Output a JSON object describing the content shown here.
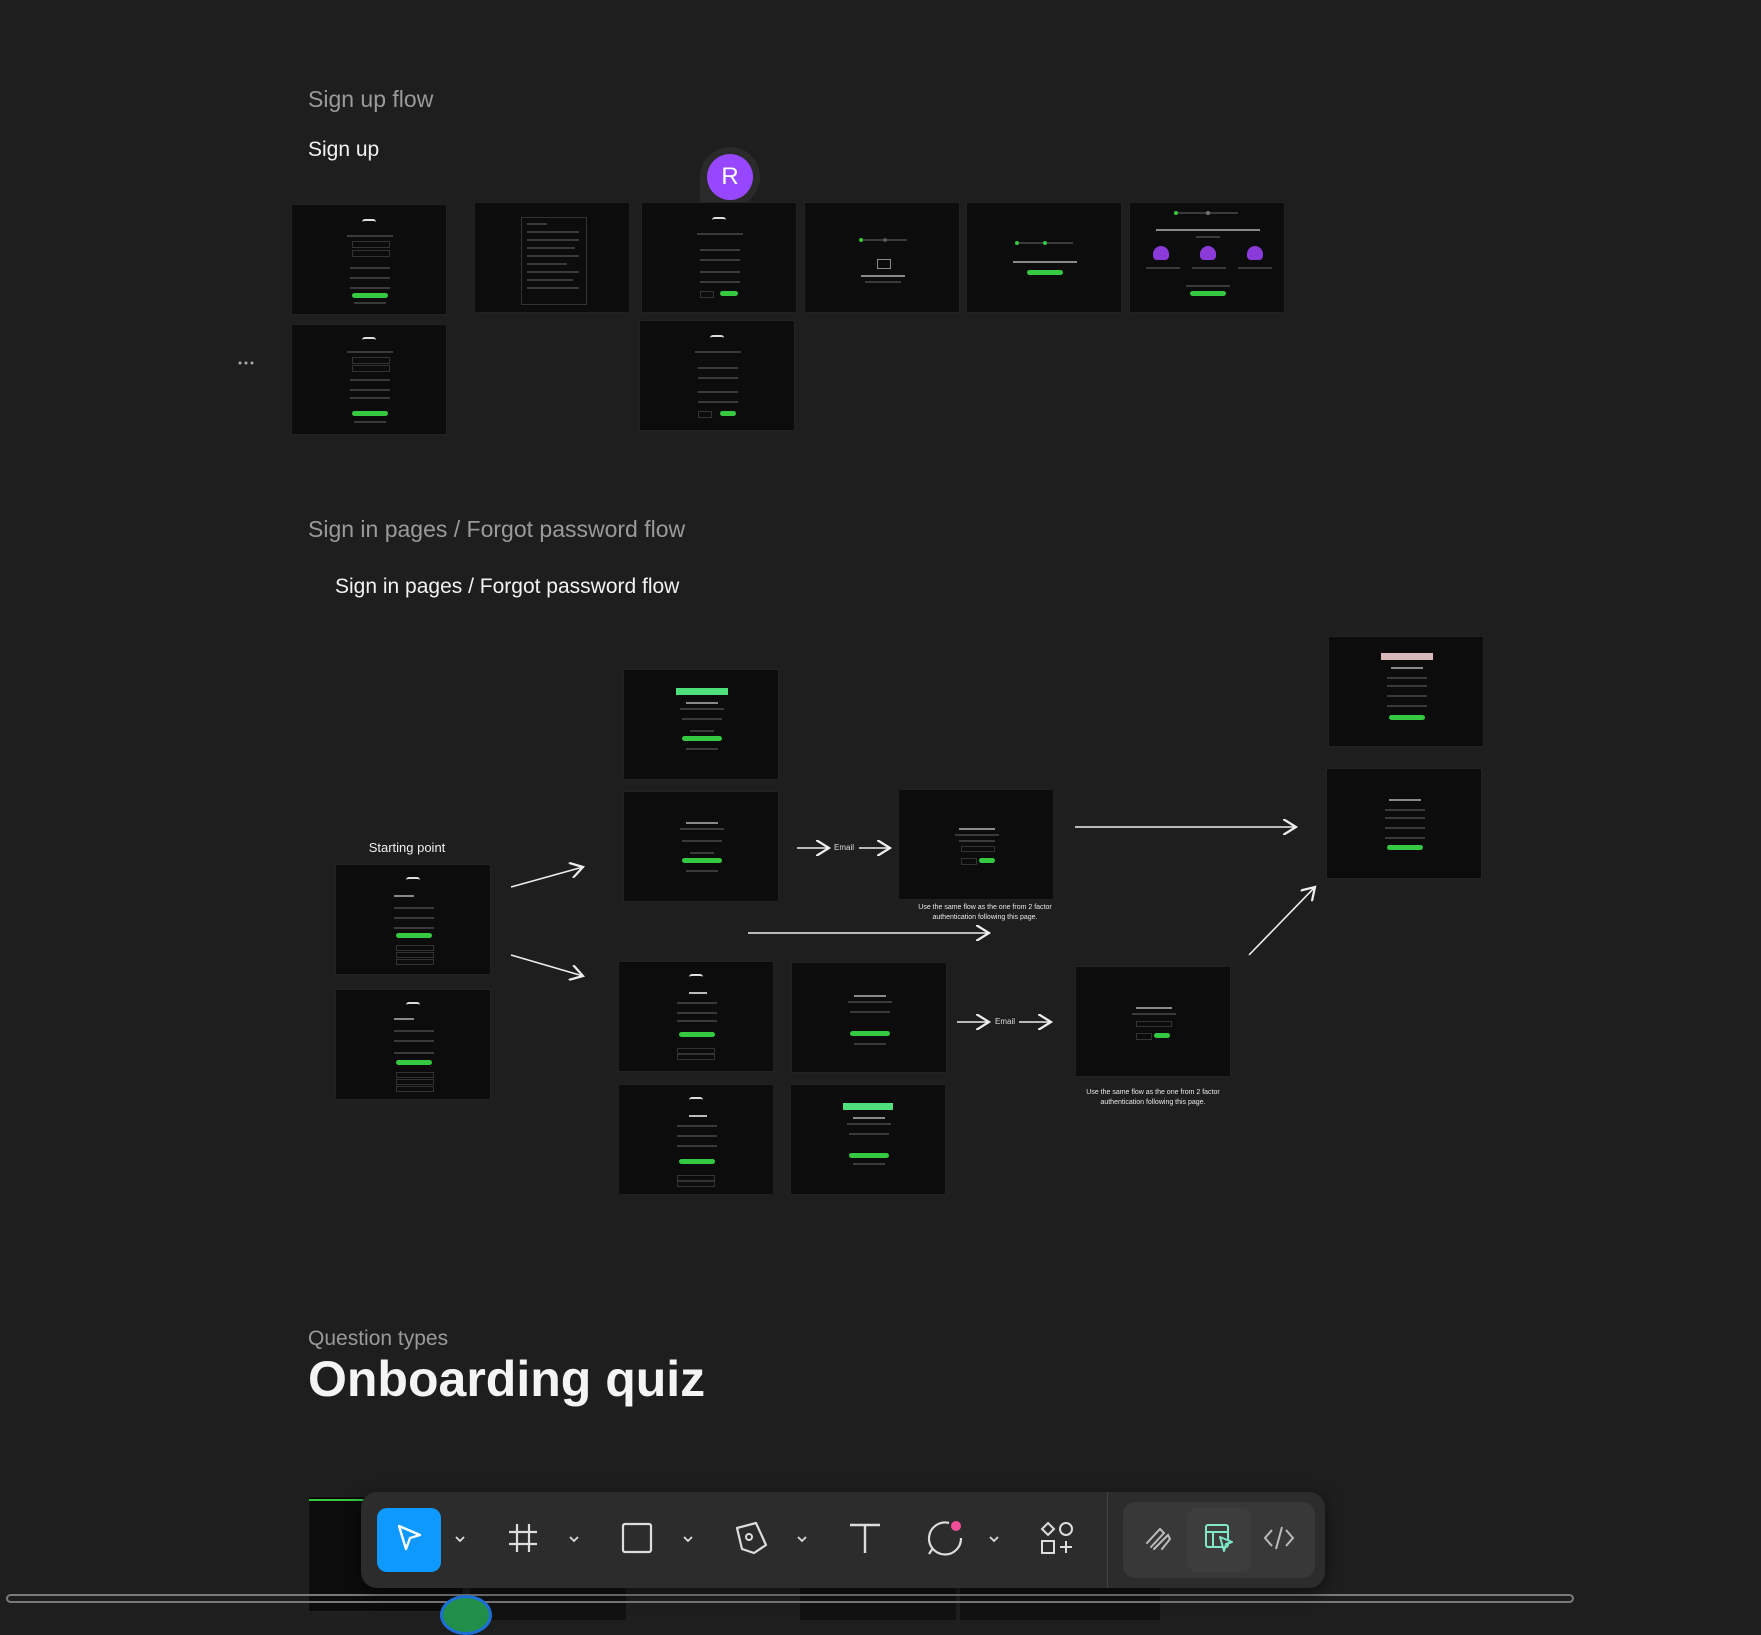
{
  "sections": {
    "signup": {
      "label": "Sign up flow",
      "frame_title": "Sign up"
    },
    "signin": {
      "label": "Sign in pages / Forgot password flow",
      "frame_title": "Sign in pages / Forgot password flow"
    },
    "quiz": {
      "label": "Question types",
      "frame_title": "Onboarding quiz"
    }
  },
  "flow": {
    "starting_point": "Starting point",
    "email_label_1": "Email",
    "email_label_2": "Email",
    "note_1": "Use the same flow as the one from 2 factor authentication following this page.",
    "note_2": "Use the same flow as the one from 2 factor authentication following this page."
  },
  "collaborator": {
    "initial": "R",
    "color": "#9747ff"
  },
  "toolbar": {
    "tools": [
      {
        "name": "move-tool",
        "icon": "pointer-icon",
        "active": true
      },
      {
        "name": "frame-tool",
        "icon": "frame-icon"
      },
      {
        "name": "shape-tool",
        "icon": "rectangle-icon"
      },
      {
        "name": "pen-tool",
        "icon": "pen-icon"
      },
      {
        "name": "text-tool",
        "icon": "text-icon"
      },
      {
        "name": "comment-tool",
        "icon": "comment-icon"
      },
      {
        "name": "actions-tool",
        "icon": "components-icon"
      }
    ],
    "modes": [
      {
        "name": "draw-mode",
        "icon": "draw-icon"
      },
      {
        "name": "design-mode",
        "icon": "design-icon",
        "selected": true
      },
      {
        "name": "dev-mode",
        "icon": "code-icon"
      }
    ]
  },
  "colors": {
    "canvas": "#1e1e1e",
    "accent": "#0d99ff",
    "success": "#34c940"
  }
}
